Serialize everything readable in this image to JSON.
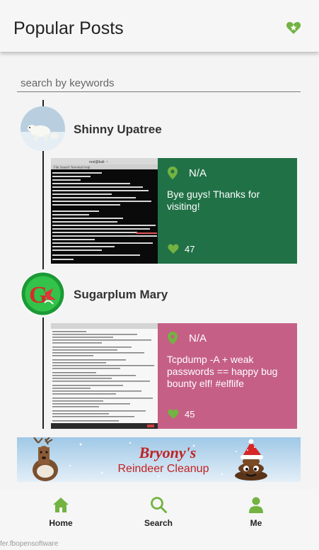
{
  "app_bar": {
    "title": "Popular Posts",
    "favorites_icon": "heart-star-icon"
  },
  "search": {
    "placeholder": "search by keywords"
  },
  "posts": [
    {
      "username": "Shinny Upatree",
      "location": "N/A",
      "message": "Bye guys! Thanks for visiting!",
      "likes": "47",
      "card_color": "#217147",
      "screenshot_title": "root@kali: ~"
    },
    {
      "username": "Sugarplum Mary",
      "location": "N/A",
      "message": "Tcpdump -A + weak passwords == happy bug bounty elf! #elflife",
      "likes": "45",
      "card_color": "#c55f85"
    }
  ],
  "banner": {
    "line1": "Bryony's",
    "line2": "Reindeer Cleanup"
  },
  "nav": [
    {
      "label": "Home",
      "icon": "home-icon"
    },
    {
      "label": "Search",
      "icon": "search-icon"
    },
    {
      "label": "Me",
      "icon": "person-icon"
    }
  ],
  "colors": {
    "accent": "#73b341",
    "text": "#222222"
  },
  "footer": {
    "text": "fer.fbopensoftware"
  }
}
